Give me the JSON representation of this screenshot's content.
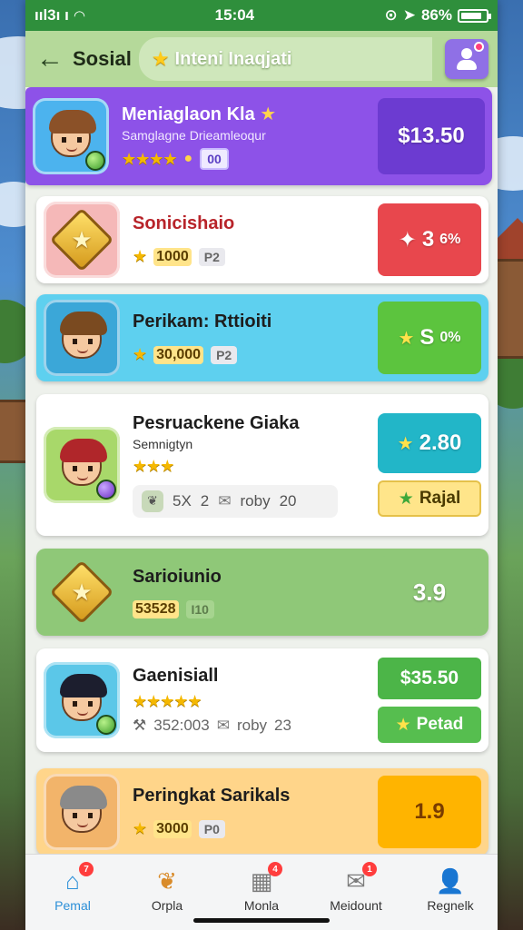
{
  "status": {
    "time_left": "ııl3ı ı",
    "time": "15:04",
    "battery": "86%"
  },
  "header": {
    "back_icon": "arrow-left-icon",
    "title": "Sosial",
    "banner": "Inteni Inaqjati"
  },
  "cards": [
    {
      "name": "Meniaglaon Kla",
      "sub": "Samglagne Drieamleoqur",
      "stars": "★★★★",
      "coins": "",
      "tag": "00",
      "price": "$13.50",
      "bg": "#8d52e8",
      "price_bg": "#6c3bd1",
      "avatar_bg": "#4cb3ee",
      "hair": "#8b5128"
    },
    {
      "name": "Sonicishaio",
      "stars": "★",
      "coins": "1000",
      "tag": "P2",
      "price": "3",
      "price_suffix": "6%",
      "bg": "#ffffff",
      "price_bg": "#e8474d",
      "avatar_bg": "#f5b8b8"
    },
    {
      "name": "Perikam: Rttioiti",
      "stars": "★",
      "coins": "30,000",
      "tag": "P2",
      "price": "S",
      "price_suffix": "0%",
      "bg": "#5ed0ef",
      "price_bg": "#5cc43e",
      "avatar_bg": "#3ba7d8",
      "hair": "#7a4a20"
    },
    {
      "name": "Pesruackene Giaka",
      "sub": "Semnigtyn",
      "stars": "★★★",
      "coins": "",
      "tag": "",
      "price": "2.80",
      "button": "Rajal",
      "extras": {
        "a": "5X",
        "b": "2",
        "c": "roby",
        "d": "20"
      },
      "bg": "#ffffff",
      "price_bg": "#22b6c8",
      "avatar_bg": "#a8d86a",
      "hair": "#b0262a"
    },
    {
      "name": "Sarioiunio",
      "stars": "",
      "coins": "53528",
      "tag": "I10",
      "price": "3.9",
      "bg": "#8fc878",
      "price_bg": "#8fc878",
      "avatar_bg": "transparent"
    },
    {
      "name": "Gaenisiall",
      "stars": "★★★★★",
      "coins": "",
      "tag": "",
      "price": "$35.50",
      "button": "Petad",
      "extras": {
        "a": "352:003",
        "c": "roby",
        "d": "23"
      },
      "bg": "#ffffff",
      "price_bg": "#4cb548",
      "avatar_bg": "#5bc7e8",
      "hair": "#1c1e2e"
    },
    {
      "name": "Peringkat Sarikals",
      "stars": "★",
      "coins": "3000",
      "tag": "P0",
      "price": "1.9",
      "bg": "#ffd58a",
      "price_bg": "#ffb400",
      "avatar_bg": "#f2b46a",
      "hair": "#8a8a8a"
    }
  ],
  "tabs": [
    {
      "label": "Pemal",
      "icon": "home-icon",
      "badge": "7",
      "active": true
    },
    {
      "label": "Orpla",
      "icon": "leaf-icon",
      "badge": ""
    },
    {
      "label": "Monla",
      "icon": "grid-icon",
      "badge": "4"
    },
    {
      "label": "Meidount",
      "icon": "mail-icon",
      "badge": "1"
    },
    {
      "label": "Regnelk",
      "icon": "person-icon",
      "badge": ""
    }
  ]
}
